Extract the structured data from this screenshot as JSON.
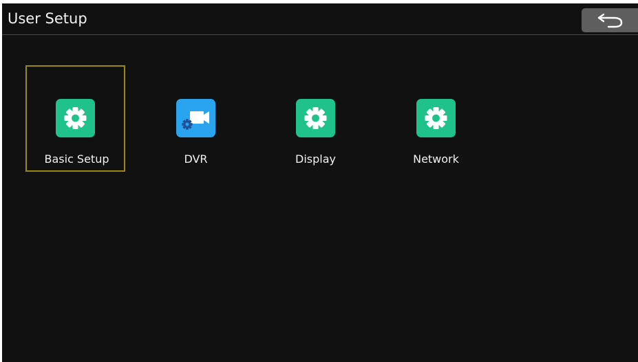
{
  "header": {
    "title": "User Setup",
    "back_icon": "back-arrow-icon"
  },
  "colors": {
    "background": "#111111",
    "header_divider": "#4a4a4a",
    "back_button": "#5e5e5e",
    "selection_border": "#9a8a12",
    "green_icon": "#1fc28a",
    "blue_icon": "#2ba4ef",
    "text": "#f2f2f2"
  },
  "menu": {
    "selected": "Basic Setup",
    "items": [
      {
        "label": "Basic Setup",
        "icon": "gear-icon"
      },
      {
        "label": "DVR",
        "icon": "video-camera-gear-icon"
      },
      {
        "label": "Display",
        "icon": "gear-icon"
      },
      {
        "label": "Network",
        "icon": "gear-icon"
      }
    ]
  }
}
